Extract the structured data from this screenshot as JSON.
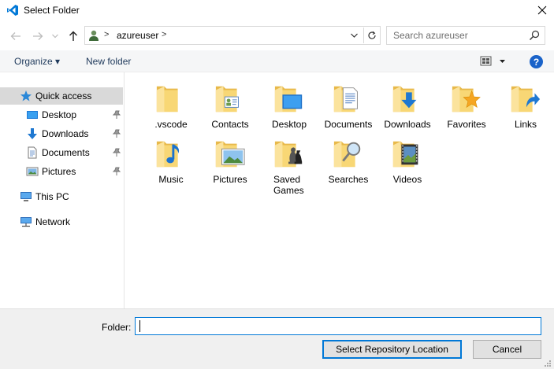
{
  "window": {
    "title": "Select Folder",
    "app_icon": "vscode-icon",
    "close_icon": "close-icon"
  },
  "address": {
    "back_icon": "arrow-left-icon",
    "forward_icon": "arrow-right-icon",
    "recent_icon": "chevron-down-icon",
    "up_icon": "arrow-up-icon",
    "location_icon": "user-icon",
    "sep1": ">",
    "crumb": "azureuser",
    "sep2": ">",
    "refresh_icon": "refresh-icon"
  },
  "search": {
    "placeholder": "Search azureuser",
    "icon": "search-icon"
  },
  "toolbar": {
    "organize": "Organize ▾",
    "new_folder": "New folder",
    "help": "?"
  },
  "nav": {
    "quick_access": "Quick access",
    "items": [
      {
        "label": "Desktop",
        "icon": "desktop-icon",
        "pinned": true
      },
      {
        "label": "Downloads",
        "icon": "downloads-icon",
        "pinned": true
      },
      {
        "label": "Documents",
        "icon": "documents-icon",
        "pinned": true
      },
      {
        "label": "Pictures",
        "icon": "pictures-icon",
        "pinned": true
      }
    ],
    "this_pc": "This PC",
    "network": "Network"
  },
  "folders": [
    {
      "name": ".vscode",
      "overlay": "none"
    },
    {
      "name": "Contacts",
      "overlay": "contact-card"
    },
    {
      "name": "Desktop",
      "overlay": "desktop-screen"
    },
    {
      "name": "Documents",
      "overlay": "document-page"
    },
    {
      "name": "Downloads",
      "overlay": "download-arrow"
    },
    {
      "name": "Favorites",
      "overlay": "star"
    },
    {
      "name": "Links",
      "overlay": "link-arrow"
    },
    {
      "name": "Music",
      "overlay": "music-note"
    },
    {
      "name": "Pictures",
      "overlay": "landscape-photo"
    },
    {
      "name": "Saved Games",
      "overlay": "chess-pieces"
    },
    {
      "name": "Searches",
      "overlay": "magnifier"
    },
    {
      "name": "Videos",
      "overlay": "film-strip"
    }
  ],
  "footer": {
    "folder_label": "Folder:",
    "folder_value": "",
    "select_button": "Select Repository Location",
    "cancel_button": "Cancel"
  },
  "colors": {
    "accent": "#0078d7",
    "folder": "#f8d775",
    "folder_dark": "#e8b94a",
    "selected_nav": "#d9d9d9",
    "button": "#e1e1e1"
  }
}
